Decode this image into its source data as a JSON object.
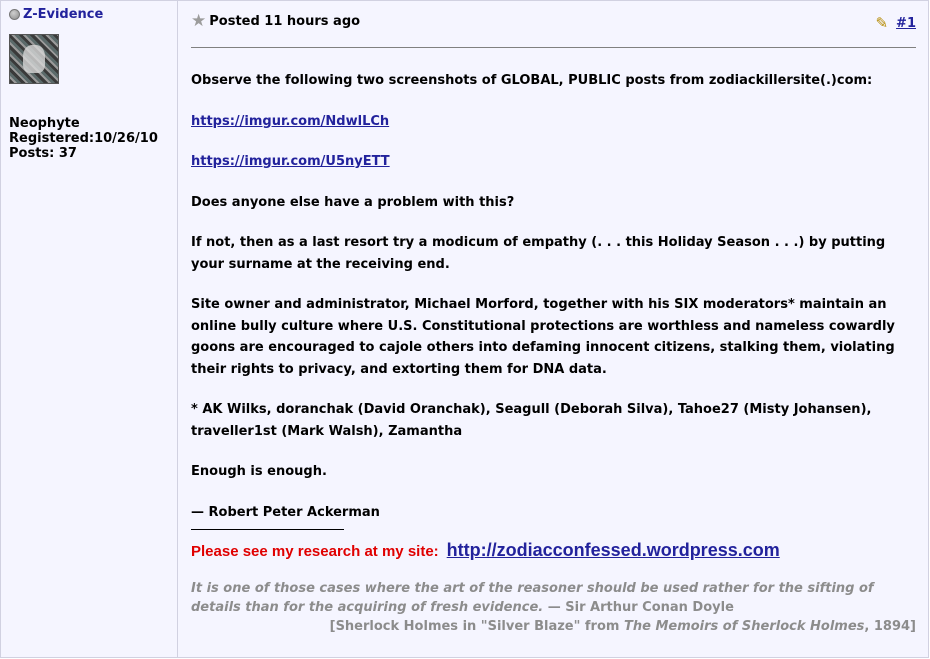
{
  "user": {
    "name": "Z-Evidence",
    "rank": "Neophyte",
    "registered": "Registered:10/26/10",
    "posts": "Posts: 37"
  },
  "header": {
    "posted": "Posted 11 hours ago",
    "post_number": "#1"
  },
  "body": {
    "intro": "Observe the following two screenshots of GLOBAL, PUBLIC posts from zodiackillersite(.)com:",
    "link1": "https://imgur.com/NdwlLCh",
    "link2": "https://imgur.com/U5nyETT",
    "question": "Does anyone else have a problem with this?",
    "empathy": "If not, then as a last resort try a modicum of empathy (. . . this Holiday Season . . .) by putting your surname at the receiving end.",
    "owner": "Site owner and administrator, Michael Morford, together with his SIX moderators* maintain an online bully culture where U.S. Constitutional protections are worthless and nameless cowardly goons are encouraged to cajole others into defaming innocent citizens, stalking them, violating their rights to privacy, and extorting them for DNA data.",
    "footnote": "* AK Wilks, doranchak (David Oranchak), Seagull (Deborah Silva), Tahoe27 (Misty Johansen), traveller1st (Mark Walsh), Zamantha",
    "enough": "Enough is enough.",
    "signoff": "— Robert Peter Ackerman"
  },
  "signature": {
    "research_label": "Please see my research at my site:",
    "site_link": "http://zodiacconfessed.wordpress.com",
    "quote_text": "It is one of those cases where the art of the reasoner should be used rather for the sifting of details than for the acquiring of fresh evidence.",
    "quote_author": "— Sir Arthur Conan Doyle",
    "cite_pre": "[Sherlock Holmes in \"Silver Blaze\" from ",
    "cite_book": "The Memoirs of Sherlock Holmes",
    "cite_post": ", 1894]"
  },
  "colors": {
    "link": "#22229c",
    "red_label": "#e00000",
    "quote_gray": "#8c8c8c",
    "panel_bg": "#f5f5ff"
  },
  "icons": {
    "status": "offline-status-icon",
    "post_icon": "star-icon",
    "edit": "pencil-icon"
  }
}
